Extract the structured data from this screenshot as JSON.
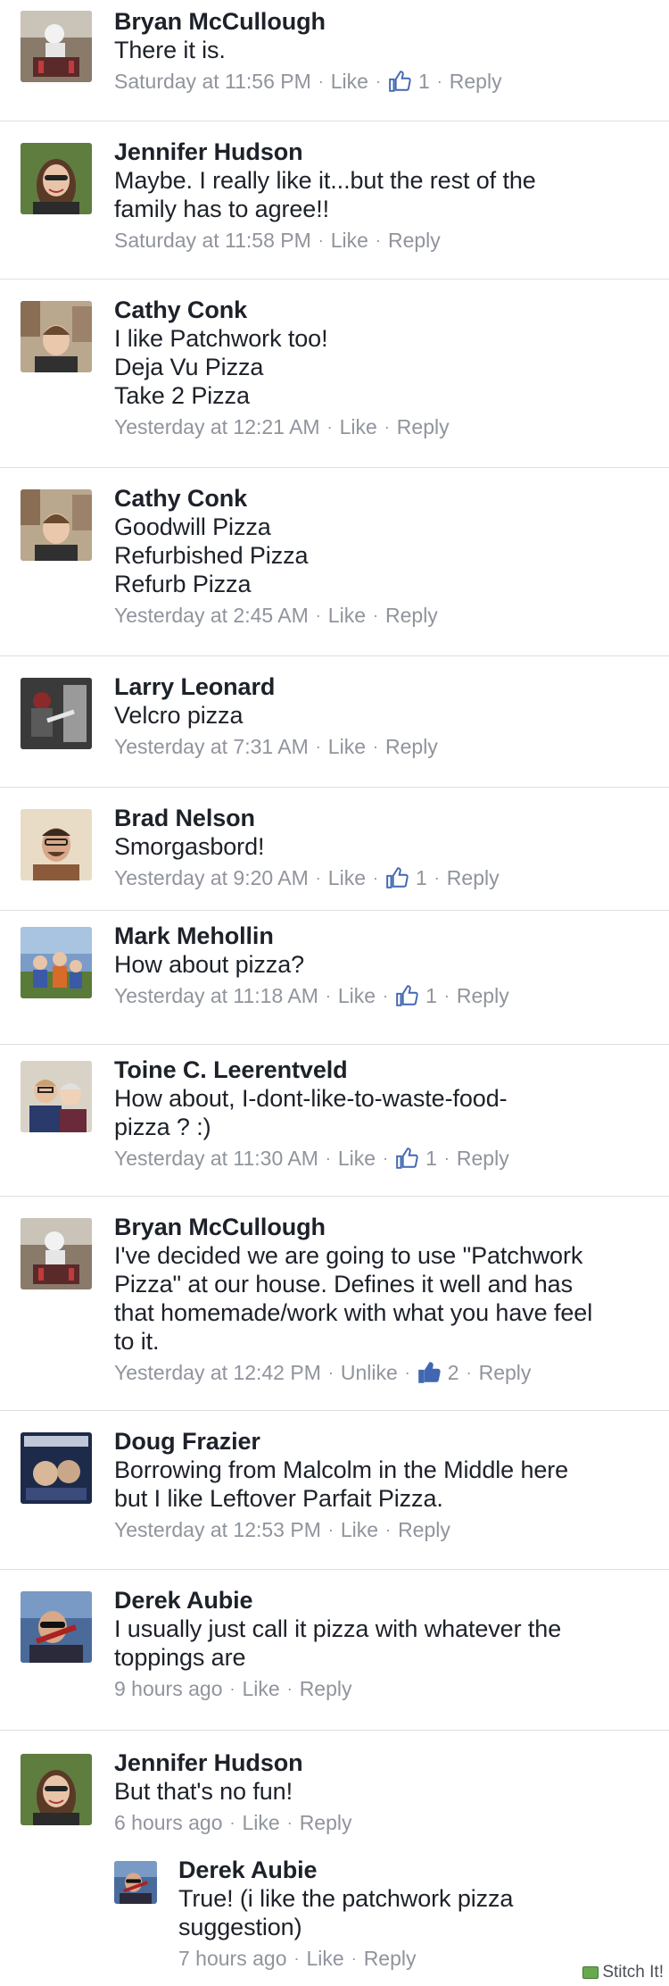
{
  "comments": [
    {
      "name": "Bryan McCullough",
      "text": "There it is.",
      "time": "Saturday at 11:56 PM",
      "like": "Like",
      "reply": "Reply",
      "likes": "1"
    },
    {
      "name": "Jennifer Hudson",
      "text": "Maybe. I really like it...but the rest of the\nfamily has to agree!!",
      "time": "Saturday at 11:58 PM",
      "like": "Like",
      "reply": "Reply"
    },
    {
      "name": "Cathy Conk",
      "text": "I like Patchwork too!\nDeja Vu Pizza\nTake 2 Pizza",
      "time": "Yesterday at 12:21 AM",
      "like": "Like",
      "reply": "Reply"
    },
    {
      "name": "Cathy Conk",
      "text": "Goodwill Pizza\nRefurbished Pizza\nRefurb Pizza",
      "time": "Yesterday at 2:45 AM",
      "like": "Like",
      "reply": "Reply"
    },
    {
      "name": "Larry Leonard",
      "text": "Velcro pizza",
      "time": "Yesterday at 7:31 AM",
      "like": "Like",
      "reply": "Reply"
    },
    {
      "name": "Brad Nelson",
      "text": "Smorgasbord!",
      "time": "Yesterday at 9:20 AM",
      "like": "Like",
      "reply": "Reply",
      "likes": "1"
    },
    {
      "name": "Mark Mehollin",
      "text": "How about pizza?",
      "time": "Yesterday at 11:18 AM",
      "like": "Like",
      "reply": "Reply",
      "likes": "1"
    },
    {
      "name": "Toine C. Leerentveld",
      "text": "How about, I-dont-like-to-waste-food-\npizza ? :)",
      "time": "Yesterday at 11:30 AM",
      "like": "Like",
      "reply": "Reply",
      "likes": "1"
    },
    {
      "name": "Bryan McCullough",
      "text": "I've decided we are going to use \"Patchwork\nPizza\" at our house. Defines it well and has\nthat homemade/work with what you have feel\nto it.",
      "time": "Yesterday at 12:42 PM",
      "like": "Unlike",
      "reply": "Reply",
      "likes": "2"
    },
    {
      "name": "Doug Frazier",
      "text": "Borrowing from Malcolm in the Middle here\nbut I like Leftover Parfait Pizza.",
      "time": "Yesterday at 12:53 PM",
      "like": "Like",
      "reply": "Reply"
    },
    {
      "name": "Derek Aubie",
      "text": "I usually just call it pizza with whatever the\ntoppings are",
      "time": "9 hours ago",
      "like": "Like",
      "reply": "Reply"
    },
    {
      "name": "Jennifer Hudson",
      "text": "But that's no fun!",
      "time": "6 hours ago",
      "like": "Like",
      "reply": "Reply"
    }
  ],
  "reply": {
    "name": "Derek Aubie",
    "text": "True!  (i like the patchwork pizza\nsuggestion)",
    "time": "7 hours ago",
    "like": "Like",
    "reply": "Reply"
  },
  "watermark": "Stitch It!",
  "colors": {
    "meta": "#90949c",
    "like_blue": "#4267b2",
    "divider": "#dddfe2"
  }
}
